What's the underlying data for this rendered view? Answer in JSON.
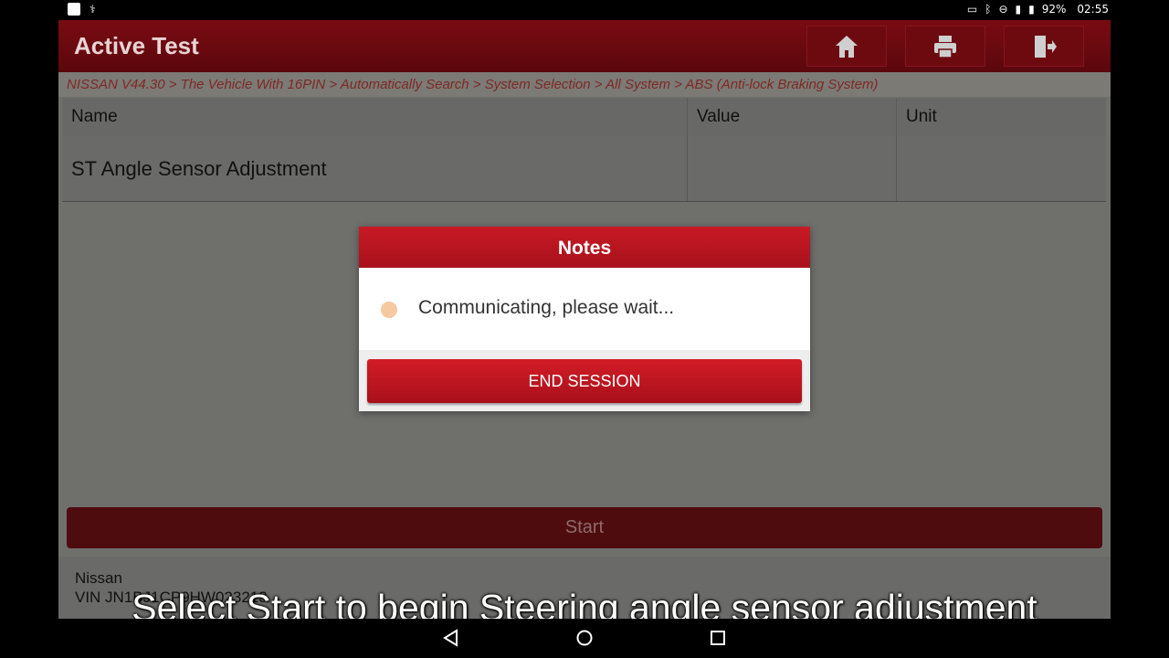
{
  "status_bar": {
    "battery": "92%",
    "time": "02:55"
  },
  "app": {
    "title": "Active Test",
    "breadcrumb": "NISSAN V44.30 > The Vehicle With 16PIN > Automatically Search > System Selection > All System > ABS (Anti-lock Braking System)"
  },
  "table": {
    "headers": [
      "Name",
      "Value",
      "Unit"
    ],
    "rows": [
      {
        "name": "ST Angle Sensor Adjustment",
        "value": "",
        "unit": ""
      }
    ]
  },
  "modal": {
    "title": "Notes",
    "message": "Communicating, please wait...",
    "end_session_label": "END SESSION"
  },
  "start_label": "Start",
  "vehicle": {
    "make": "Nissan",
    "vin": "VIN JN1BJ1CP9HW023213"
  },
  "caption": "Select Start to begin Steering angle sensor adjustment",
  "colors": {
    "header_red": "#7a0b12",
    "modal_red": "#c81a25",
    "spinner": "#f6c9a0"
  },
  "icons": {
    "home": "home-icon",
    "print": "printer-icon",
    "exit": "exit-icon"
  }
}
